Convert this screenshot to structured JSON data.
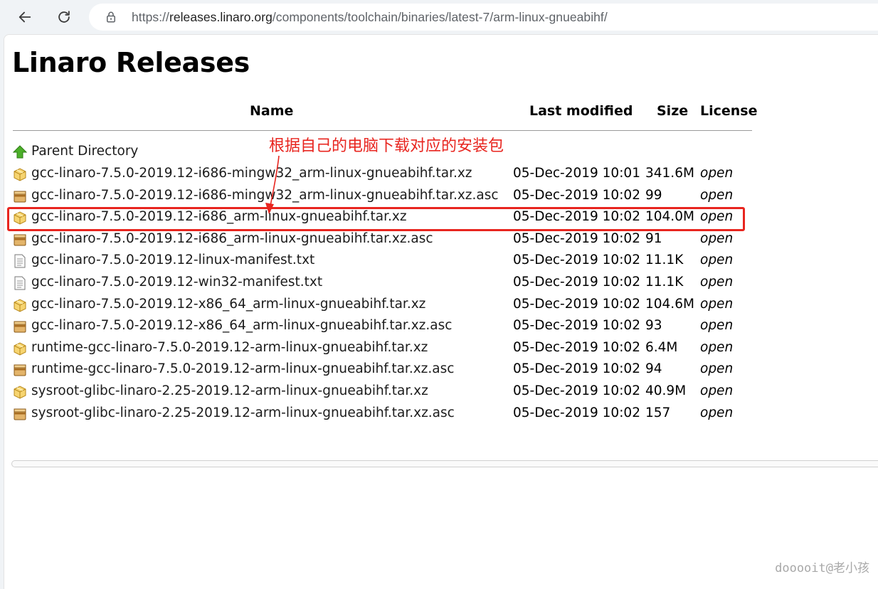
{
  "browser": {
    "url_prefix": "https://",
    "url_host": "releases.linaro.org",
    "url_path": "/components/toolchain/binaries/latest-7/arm-linux-gnueabihf/"
  },
  "page": {
    "title": "Linaro Releases",
    "columns": {
      "name": "Name",
      "last_modified": "Last modified",
      "size": "Size",
      "license": "License"
    },
    "parent_directory": "Parent Directory",
    "files": [
      {
        "name": "gcc-linaro-7.5.0-2019.12-i686-mingw32_arm-linux-gnueabihf.tar.xz",
        "modified": "05-Dec-2019 10:01",
        "size": "341.6M",
        "license": "open",
        "icon": "package-icon"
      },
      {
        "name": "gcc-linaro-7.5.0-2019.12-i686-mingw32_arm-linux-gnueabihf.tar.xz.asc",
        "modified": "05-Dec-2019 10:02",
        "size": "99",
        "license": "open",
        "icon": "archive-icon"
      },
      {
        "name": "gcc-linaro-7.5.0-2019.12-i686_arm-linux-gnueabihf.tar.xz",
        "modified": "05-Dec-2019 10:02",
        "size": "104.0M",
        "license": "open",
        "icon": "package-icon"
      },
      {
        "name": "gcc-linaro-7.5.0-2019.12-i686_arm-linux-gnueabihf.tar.xz.asc",
        "modified": "05-Dec-2019 10:02",
        "size": "91",
        "license": "open",
        "icon": "archive-icon"
      },
      {
        "name": "gcc-linaro-7.5.0-2019.12-linux-manifest.txt",
        "modified": "05-Dec-2019 10:02",
        "size": "11.1K",
        "license": "open",
        "icon": "text-file-icon"
      },
      {
        "name": "gcc-linaro-7.5.0-2019.12-win32-manifest.txt",
        "modified": "05-Dec-2019 10:02",
        "size": "11.1K",
        "license": "open",
        "icon": "text-file-icon"
      },
      {
        "name": "gcc-linaro-7.5.0-2019.12-x86_64_arm-linux-gnueabihf.tar.xz",
        "modified": "05-Dec-2019 10:02",
        "size": "104.6M",
        "license": "open",
        "icon": "package-icon"
      },
      {
        "name": "gcc-linaro-7.5.0-2019.12-x86_64_arm-linux-gnueabihf.tar.xz.asc",
        "modified": "05-Dec-2019 10:02",
        "size": "93",
        "license": "open",
        "icon": "archive-icon"
      },
      {
        "name": "runtime-gcc-linaro-7.5.0-2019.12-arm-linux-gnueabihf.tar.xz",
        "modified": "05-Dec-2019 10:02",
        "size": "6.4M",
        "license": "open",
        "icon": "package-icon"
      },
      {
        "name": "runtime-gcc-linaro-7.5.0-2019.12-arm-linux-gnueabihf.tar.xz.asc",
        "modified": "05-Dec-2019 10:02",
        "size": "94",
        "license": "open",
        "icon": "archive-icon"
      },
      {
        "name": "sysroot-glibc-linaro-2.25-2019.12-arm-linux-gnueabihf.tar.xz",
        "modified": "05-Dec-2019 10:02",
        "size": "40.9M",
        "license": "open",
        "icon": "package-icon"
      },
      {
        "name": "sysroot-glibc-linaro-2.25-2019.12-arm-linux-gnueabihf.tar.xz.asc",
        "modified": "05-Dec-2019 10:02",
        "size": "157",
        "license": "open",
        "icon": "archive-icon"
      }
    ]
  },
  "annotation": {
    "text": "根据自己的电脑下载对应的安装包",
    "color": "#e8251f"
  },
  "watermark": "dooooit@老小孩"
}
